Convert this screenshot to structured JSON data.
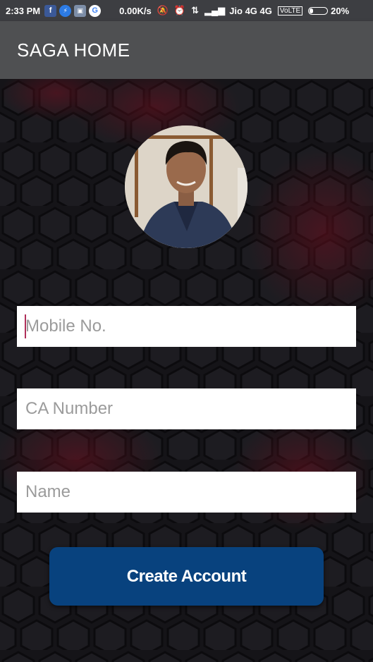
{
  "status_bar": {
    "time": "2:33 PM",
    "speed": "0.00K/s",
    "carrier": "Jio 4G 4G",
    "volte": "VoLTE",
    "battery_percent": "20%",
    "battery_level": 0.2,
    "icons": [
      "facebook-icon",
      "messenger-icon",
      "gallery-icon",
      "google-icon",
      "mute-icon",
      "alarm-icon",
      "data-transfer-icon",
      "signal-icon",
      "battery-icon"
    ]
  },
  "app_bar": {
    "title": "SAGA HOME"
  },
  "form": {
    "mobile_placeholder": "Mobile No.",
    "ca_placeholder": "CA Number",
    "name_placeholder": "Name",
    "submit_label": "Create Account"
  },
  "colors": {
    "app_bar": "#4f5052",
    "status_bar": "#3d3e42",
    "background": "#151418",
    "button": "#08427e",
    "cursor": "#b0305a"
  }
}
